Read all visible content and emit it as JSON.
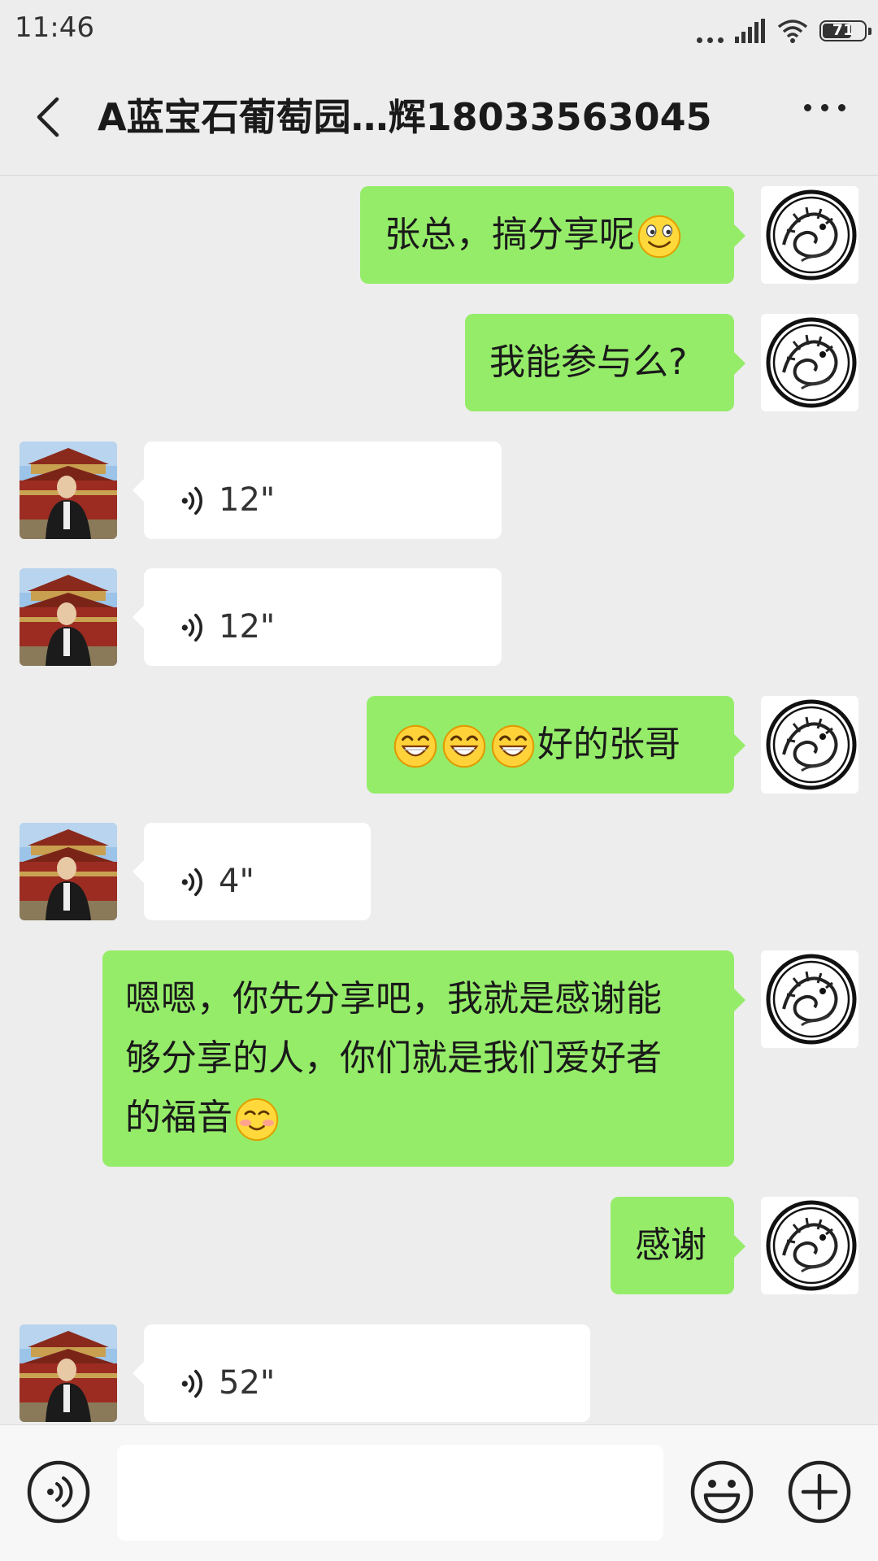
{
  "status_bar": {
    "time": "11:46",
    "battery": "71",
    "battery_level": 0.71,
    "icons": [
      "more-dots-icon",
      "signal-icon",
      "wifi-icon",
      "battery-icon"
    ]
  },
  "header": {
    "title": "A蓝宝石葡萄园…辉18033563045",
    "back_icon": "back-chevron-icon",
    "more_icon": "more-options-icon"
  },
  "messages": [
    {
      "side": "out",
      "type": "text",
      "text": "张总，搞分享呢",
      "emoji": [
        "smile-emoji"
      ]
    },
    {
      "side": "out",
      "type": "text",
      "text": "我能参与么?"
    },
    {
      "side": "in",
      "type": "voice",
      "duration": "12\""
    },
    {
      "side": "in",
      "type": "voice",
      "duration": "12\""
    },
    {
      "side": "out",
      "type": "text",
      "emoji": [
        "grin-emoji",
        "grin-emoji",
        "grin-emoji"
      ],
      "text": "好的张哥"
    },
    {
      "side": "in",
      "type": "voice",
      "duration": "4\""
    },
    {
      "side": "out",
      "type": "text",
      "lines": [
        "嗯嗯，你先分享吧，我就是感谢能",
        "够分享的人，你们就是我们爱好者",
        "的福音"
      ],
      "emoji": [
        "blush-emoji"
      ]
    },
    {
      "side": "out",
      "type": "text",
      "text": "感谢"
    },
    {
      "side": "in",
      "type": "voice",
      "duration": "52\""
    }
  ],
  "input_bar": {
    "voice_icon": "voice-input-icon",
    "emoji_icon": "emoji-icon",
    "plus_icon": "plus-icon",
    "value": ""
  },
  "colors": {
    "background": "#ededed",
    "outgoing_bubble": "#95ec69",
    "incoming_bubble": "#ffffff"
  }
}
